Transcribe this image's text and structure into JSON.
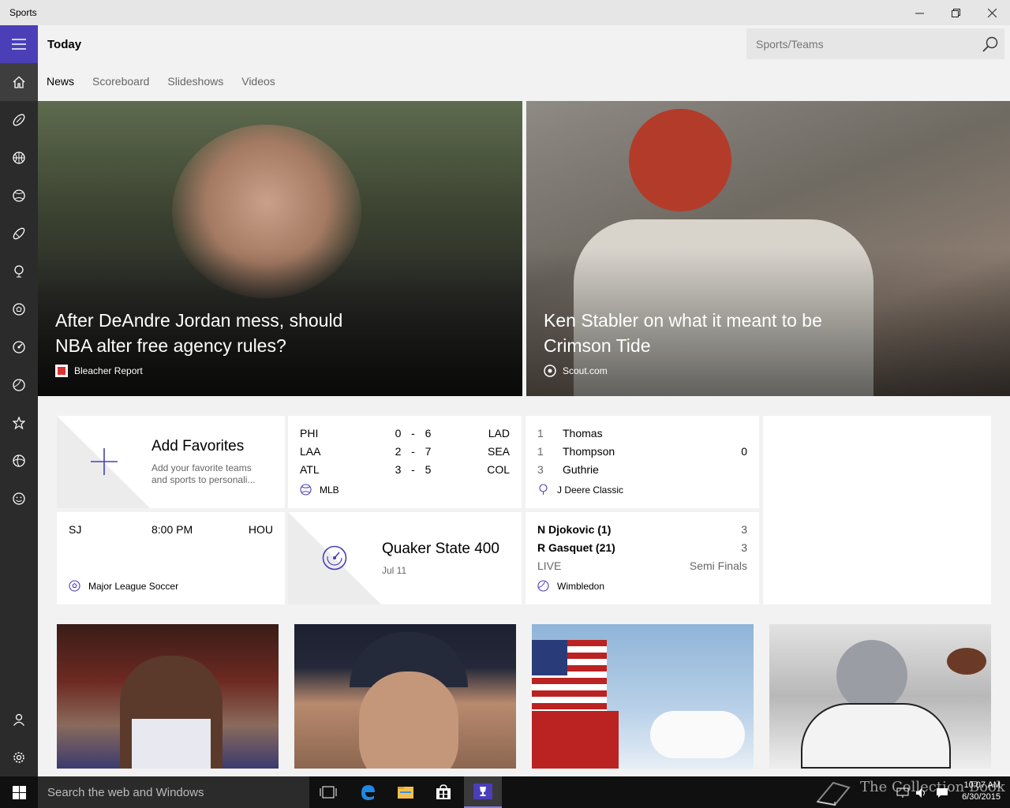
{
  "window": {
    "title": "Sports"
  },
  "header": {
    "page_title": "Today",
    "search_placeholder": "Sports/Teams"
  },
  "tabs": [
    {
      "label": "News",
      "active": true
    },
    {
      "label": "Scoreboard",
      "active": false
    },
    {
      "label": "Slideshows",
      "active": false
    },
    {
      "label": "Videos",
      "active": false
    }
  ],
  "nav": {
    "items": [
      "home-icon",
      "football-icon",
      "basketball-icon",
      "baseball-icon",
      "hockey-icon",
      "golf-icon",
      "soccer-icon",
      "racing-icon",
      "tennis-icon",
      "favorites-icon",
      "more-sports-icon",
      "fantasy-icon"
    ],
    "bottom": [
      "account-icon",
      "settings-icon"
    ]
  },
  "hero": [
    {
      "headline": "After DeAndre Jordan mess, should NBA alter free agency rules?",
      "source": "Bleacher Report"
    },
    {
      "headline": "Ken Stabler on what it meant to be Crimson Tide",
      "source": "Scout.com"
    }
  ],
  "favorites_tile": {
    "title": "Add Favorites",
    "subtitle": "Add your favorite teams and sports to personali..."
  },
  "mlb_tile": {
    "rows": [
      {
        "away": "PHI",
        "away_score": "0",
        "sep": "-",
        "home_score": "6",
        "home": "LAD"
      },
      {
        "away": "LAA",
        "away_score": "2",
        "sep": "-",
        "home_score": "7",
        "home": "SEA"
      },
      {
        "away": "ATL",
        "away_score": "3",
        "sep": "-",
        "home_score": "5",
        "home": "COL"
      }
    ],
    "league": "MLB"
  },
  "golf_tile": {
    "rows": [
      {
        "pos": "1",
        "name": "Thomas",
        "score": ""
      },
      {
        "pos": "1",
        "name": "Thompson",
        "score": "0"
      },
      {
        "pos": "3",
        "name": "Guthrie",
        "score": ""
      }
    ],
    "event": "J Deere Classic"
  },
  "soccer_tile": {
    "away": "SJ",
    "time": "8:00 PM",
    "home": "HOU",
    "league": "Major League Soccer"
  },
  "racing_tile": {
    "title": "Quaker State 400",
    "date": "Jul 11"
  },
  "tennis_tile": {
    "p1": "N Djokovic (1)",
    "p1_score": "3",
    "p2": "R Gasquet (21)",
    "p2_score": "3",
    "status": "LIVE",
    "round": "Semi Finals",
    "event": "Wimbledon"
  },
  "taskbar": {
    "search_placeholder": "Search the web and Windows",
    "time": "10:07 AM",
    "date": "6/30/2015",
    "watermark": "The Collection Book"
  },
  "colors": {
    "accent": "#4b3fb8",
    "rail": "#2b2b2b",
    "taskbar": "#101010"
  }
}
